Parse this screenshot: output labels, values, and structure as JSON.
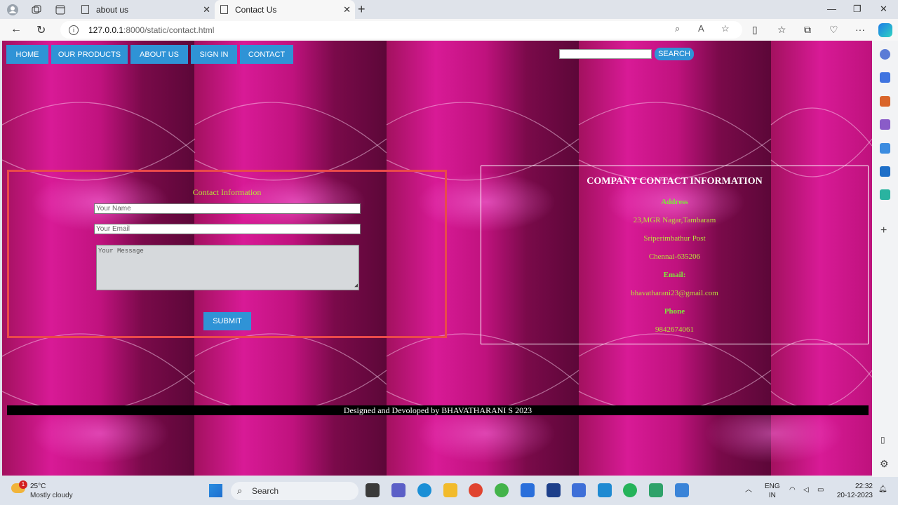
{
  "browser": {
    "tabs": [
      {
        "title": "about us",
        "active": false
      },
      {
        "title": "Contact Us",
        "active": true
      }
    ],
    "url_host": "127.0.0.1",
    "url_path": ":8000/static/contact.html"
  },
  "nav": {
    "items": [
      "HOME",
      "OUR PRODUCTS",
      "ABOUT US",
      "SIGN IN",
      "CONTACT"
    ],
    "search_button": "SEARCH"
  },
  "form": {
    "title": "Contact Information",
    "name_placeholder": "Your Name",
    "email_placeholder": "Your Email",
    "message_placeholder": "Your Message",
    "submit": "SUBMIT"
  },
  "company": {
    "title": "COMPANY CONTACT INFORMATION",
    "address_heading": "Address",
    "address_lines": [
      "23,MGR Nagar,Tambaram",
      "Sriperimbathur Post",
      "Chennai-635206"
    ],
    "email_heading": "Email:",
    "email": "bhavatharani23@gmail.com",
    "phone_heading": "Phone",
    "phone": "9842674061"
  },
  "footer": {
    "text": "Designed and Devoloped by BHAVATHARANI S 2023"
  },
  "taskbar": {
    "weather_badge": "1",
    "temperature": "25°C",
    "condition": "Mostly cloudy",
    "search_label": "Search",
    "lang_line1": "ENG",
    "lang_line2": "IN",
    "time": "22:32",
    "date": "20-12-2023"
  },
  "colors": {
    "nav_button": "#2f93d6",
    "form_border": "#ea4a4a",
    "accent_text": "#b8e33a",
    "heading_green": "#7ee83a"
  }
}
